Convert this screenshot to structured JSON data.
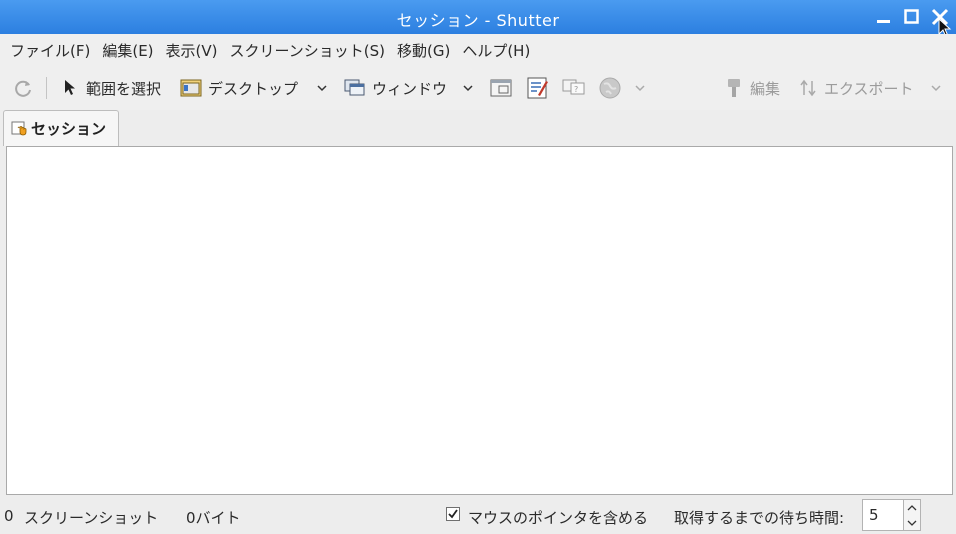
{
  "window": {
    "title": "セッション - Shutter"
  },
  "menubar": {
    "items": [
      "ファイル(F)",
      "編集(E)",
      "表示(V)",
      "スクリーンショット(S)",
      "移動(G)",
      "ヘルプ(H)"
    ]
  },
  "toolbar": {
    "select_label": "範囲を選択",
    "desktop_label": "デスクトップ",
    "window_label": "ウィンドウ",
    "edit_label": "編集",
    "export_label": "エクスポート"
  },
  "tabs": [
    {
      "label": "セッション"
    }
  ],
  "statusbar": {
    "count": "0",
    "count_label": "スクリーンショット",
    "size": "0バイト",
    "pointer_label": "マウスのポインタを含める",
    "pointer_checked": true,
    "delay_label": "取得するまでの待ち時間:",
    "delay_value": "5"
  },
  "colors": {
    "titlebar": "#2c7fe0",
    "content": "#ffffff"
  }
}
